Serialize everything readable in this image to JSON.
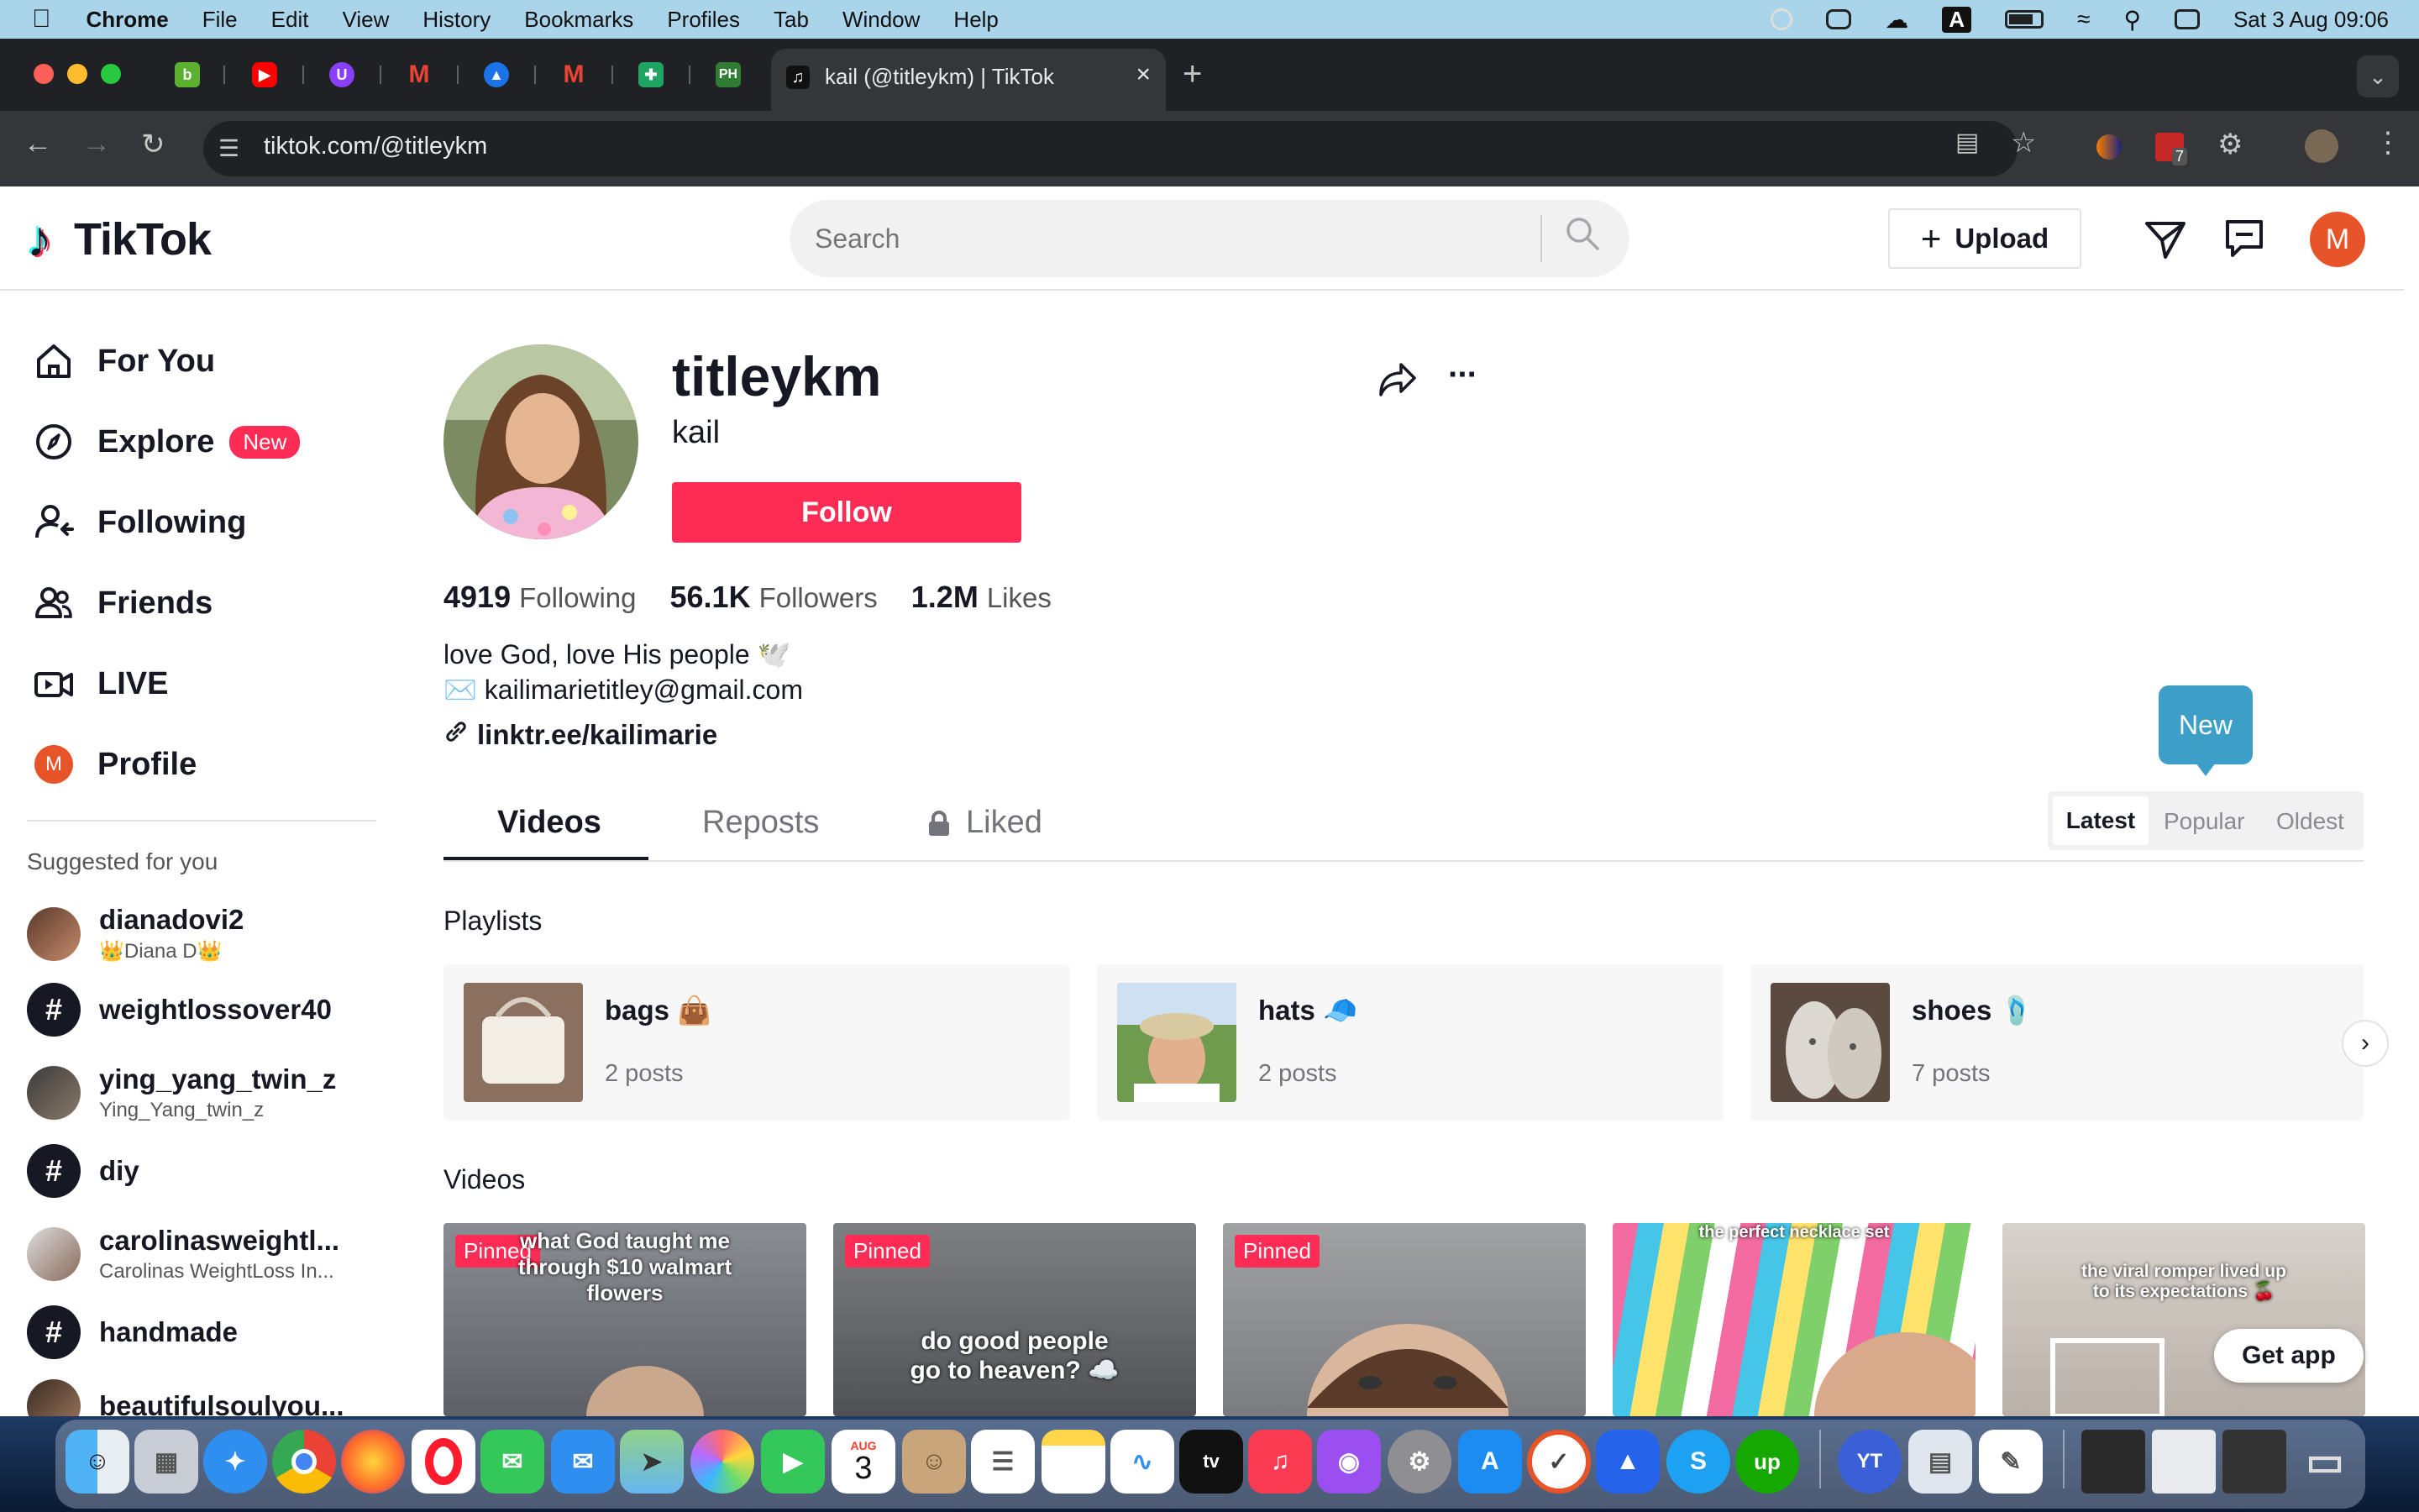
{
  "menubar": {
    "app": "Chrome",
    "items": [
      "File",
      "Edit",
      "View",
      "History",
      "Bookmarks",
      "Profiles",
      "Tab",
      "Window",
      "Help"
    ],
    "datetime": "Sat 3 Aug  09:06",
    "input_indicator": "A"
  },
  "browser": {
    "active_tab_title": "kail (@titleykm) | TikTok",
    "url": "tiktok.com/@titleykm",
    "new_tab": "+",
    "extension_badge": "7"
  },
  "header": {
    "logo": "TikTok",
    "search_placeholder": "Search",
    "upload_label": "Upload",
    "avatar_initial": "M"
  },
  "sidebar": {
    "nav": [
      {
        "label": "For You",
        "icon": "home-icon"
      },
      {
        "label": "Explore",
        "icon": "compass-icon",
        "badge": "New"
      },
      {
        "label": "Following",
        "icon": "person-follow-icon"
      },
      {
        "label": "Friends",
        "icon": "friends-icon"
      },
      {
        "label": "LIVE",
        "icon": "live-icon"
      },
      {
        "label": "Profile",
        "icon": "avatar-icon",
        "initial": "M"
      }
    ],
    "suggested_title": "Suggested for you",
    "suggested": [
      {
        "name": "dianadovi2",
        "sub": "👑Diana D👑"
      },
      {
        "name": "weightlossover40",
        "sub": ""
      },
      {
        "name": "ying_yang_twin_z",
        "sub": "Ying_Yang_twin_z"
      },
      {
        "name": "diy",
        "sub": ""
      },
      {
        "name": "carolinasweightl...",
        "sub": "Carolinas WeightLoss In..."
      },
      {
        "name": "handmade",
        "sub": ""
      },
      {
        "name": "beautifulsoulyou...",
        "sub": ""
      }
    ],
    "hashtag_symbol": "#"
  },
  "profile": {
    "username": "titleykm",
    "nickname": "kail",
    "follow_label": "Follow",
    "stats": [
      {
        "value": "4919",
        "label": "Following"
      },
      {
        "value": "56.1K",
        "label": "Followers"
      },
      {
        "value": "1.2M",
        "label": "Likes"
      }
    ],
    "bio_line1": "love God, love His people 🕊️",
    "bio_line2": "✉️ kailimarietitley@gmail.com",
    "link": "linktr.ee/kailimarie",
    "more": "···"
  },
  "tabs": {
    "items": [
      "Videos",
      "Reposts",
      "Liked"
    ],
    "active": "Videos",
    "sort": [
      "Latest",
      "Popular",
      "Oldest"
    ],
    "sort_active": "Latest",
    "tooltip": "New"
  },
  "playlists": {
    "title": "Playlists",
    "items": [
      {
        "name": "bags 👜",
        "count": "2 posts"
      },
      {
        "name": "hats 🧢",
        "count": "2 posts"
      },
      {
        "name": "shoes 🩴",
        "count": "7 posts"
      }
    ]
  },
  "videos": {
    "title": "Videos",
    "pinned_label": "Pinned",
    "items": [
      {
        "caption": "what God taught me through $10 walmart flowers"
      },
      {
        "caption": "do good people go to heaven? ☁️"
      },
      {
        "caption": ""
      },
      {
        "caption": "the perfect necklace set"
      },
      {
        "caption": "the viral romper lived up to its expectations 🍒"
      }
    ],
    "get_app": "Get app"
  },
  "dock": {
    "calendar_month": "AUG",
    "calendar_day": "3",
    "tv_label": "tv"
  },
  "colors": {
    "accent": "#fe2c55",
    "tooltip": "#3d9fc7",
    "menubar": "#a9d4ea"
  }
}
